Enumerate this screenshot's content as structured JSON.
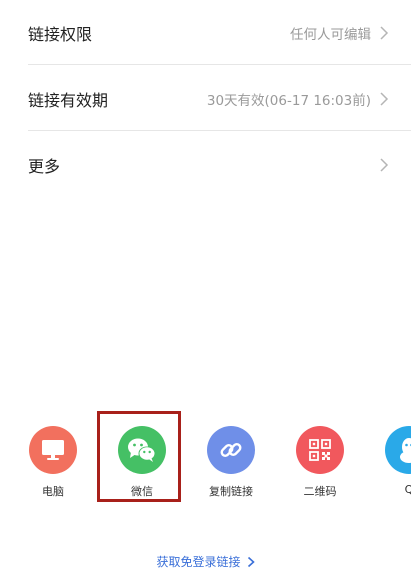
{
  "settings": {
    "rows": [
      {
        "label": "链接权限",
        "value": "任何人可编辑"
      },
      {
        "label": "链接有效期",
        "value": "30天有效(06-17 16:03前)"
      },
      {
        "label": "更多",
        "value": ""
      }
    ]
  },
  "share": {
    "items": [
      {
        "label": "电脑",
        "icon": "monitor-icon",
        "color": "#f2705e"
      },
      {
        "label": "微信",
        "icon": "wechat-icon",
        "color": "#45c065"
      },
      {
        "label": "复制链接",
        "icon": "link-icon",
        "color": "#6f8fe8"
      },
      {
        "label": "二维码",
        "icon": "qrcode-icon",
        "color": "#f1585d"
      },
      {
        "label": "Q",
        "icon": "qq-icon",
        "color": "#2aa9e8"
      }
    ]
  },
  "footer": {
    "link_label": "获取免登录链接"
  },
  "colors": {
    "highlight_border": "#a8201a",
    "link": "#3a6fd8",
    "value_text": "#9a9a9a"
  }
}
